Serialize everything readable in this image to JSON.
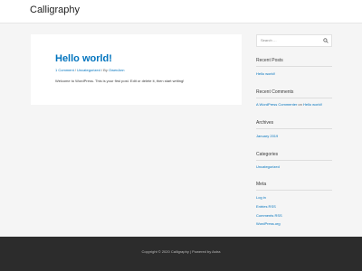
{
  "header": {
    "site_title": "Calligraphy"
  },
  "post": {
    "title": "Hello world!",
    "meta": {
      "comments": "1 Comment",
      "sep1": " / ",
      "category": "Uncategorized",
      "by": " / By ",
      "author": "OwenAnn"
    },
    "body": "Welcome to WordPress. This is your first post. Edit or delete it, then start writing!"
  },
  "sidebar": {
    "search": {
      "placeholder": "Search …"
    },
    "recent_posts": {
      "title": "Recent Posts",
      "items": [
        "Hello world!"
      ]
    },
    "recent_comments": {
      "title": "Recent Comments",
      "commenter": "A WordPress Commenter",
      "on": " on ",
      "post": "Hello world!"
    },
    "archives": {
      "title": "Archives",
      "items": [
        "January 2019"
      ]
    },
    "categories": {
      "title": "Categories",
      "items": [
        "Uncategorized"
      ]
    },
    "meta": {
      "title": "Meta",
      "items": [
        "Log in",
        "Entries RSS",
        "Comments RSS",
        "WordPress.org"
      ]
    }
  },
  "footer": {
    "text": "Copyright © 2020 Calligraphy | Powered by Astra"
  }
}
